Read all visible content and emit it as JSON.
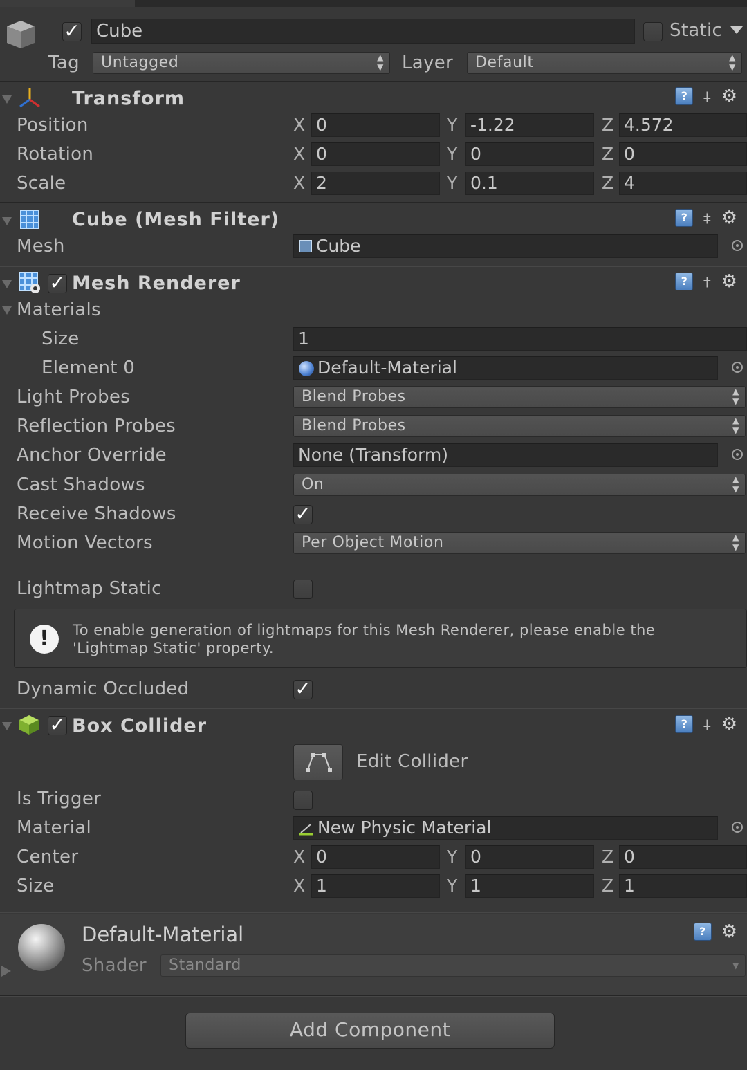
{
  "object": {
    "name": "Cube",
    "enabled": true,
    "static_label": "Static",
    "static": false,
    "tag_label": "Tag",
    "tag": "Untagged",
    "layer_label": "Layer",
    "layer": "Default"
  },
  "transform": {
    "title": "Transform",
    "position": {
      "label": "Position",
      "x": "0",
      "y": "-1.22",
      "z": "4.572"
    },
    "rotation": {
      "label": "Rotation",
      "x": "0",
      "y": "0",
      "z": "0"
    },
    "scale": {
      "label": "Scale",
      "x": "2",
      "y": "0.1",
      "z": "4"
    }
  },
  "axis": {
    "x": "X",
    "y": "Y",
    "z": "Z"
  },
  "mesh_filter": {
    "title": "Cube (Mesh Filter)",
    "mesh_label": "Mesh",
    "mesh": "Cube"
  },
  "mesh_renderer": {
    "title": "Mesh Renderer",
    "enabled": true,
    "materials_label": "Materials",
    "size_label": "Size",
    "size": "1",
    "element0_label": "Element 0",
    "element0": "Default-Material",
    "light_probes_label": "Light Probes",
    "light_probes": "Blend Probes",
    "reflection_probes_label": "Reflection Probes",
    "reflection_probes": "Blend Probes",
    "anchor_override_label": "Anchor Override",
    "anchor_override": "None (Transform)",
    "cast_shadows_label": "Cast Shadows",
    "cast_shadows": "On",
    "receive_shadows_label": "Receive Shadows",
    "receive_shadows": true,
    "motion_vectors_label": "Motion Vectors",
    "motion_vectors": "Per Object Motion",
    "lightmap_static_label": "Lightmap Static",
    "lightmap_static": false,
    "info_line1": "To enable generation of lightmaps for this Mesh Renderer, please enable the",
    "info_line2": "'Lightmap Static' property.",
    "dynamic_occluded_label": "Dynamic Occluded",
    "dynamic_occluded": true
  },
  "box_collider": {
    "title": "Box Collider",
    "enabled": true,
    "edit_collider_label": "Edit Collider",
    "is_trigger_label": "Is Trigger",
    "is_trigger": false,
    "material_label": "Material",
    "material": "New Physic Material",
    "center": {
      "label": "Center",
      "x": "0",
      "y": "0",
      "z": "0"
    },
    "size": {
      "label": "Size",
      "x": "1",
      "y": "1",
      "z": "1"
    }
  },
  "material": {
    "name": "Default-Material",
    "shader_label": "Shader",
    "shader": "Standard"
  },
  "add_component_label": "Add Component",
  "icons": {
    "help": "?",
    "gear": "⚙",
    "check": "✓"
  }
}
